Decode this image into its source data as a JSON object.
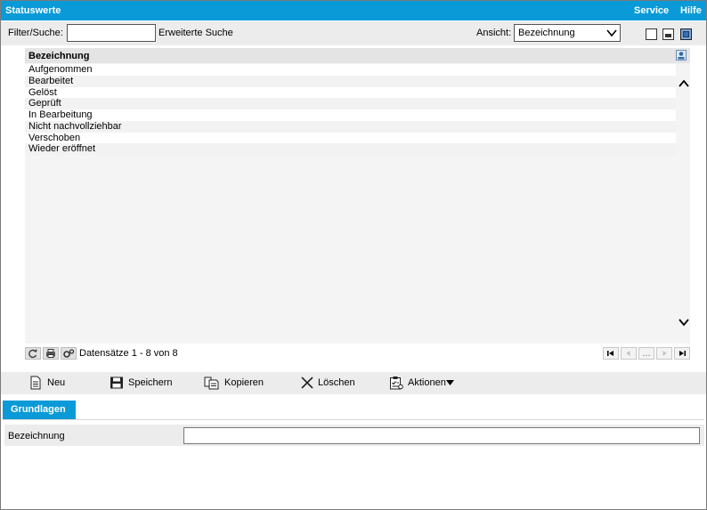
{
  "window": {
    "title": "Statuswerte",
    "menu": [
      "Service",
      "Hilfe"
    ]
  },
  "filter": {
    "label": "Filter/Suche:",
    "value": "",
    "advanced_search": "Erweiterte Suche",
    "view_label": "Ansicht:",
    "view_value": "Bezeichnung"
  },
  "grid": {
    "column": "Bezeichnung",
    "rows": [
      "Aufgenommen",
      "Bearbeitet",
      "Gelöst",
      "Geprüft",
      "In Bearbeitung",
      "Nicht nachvollziehbar",
      "Verschoben",
      "Wieder eröffnet"
    ],
    "records": "Datensätze 1 - 8 von 8",
    "pager_ellipsis": "..."
  },
  "toolbar": {
    "new": "Neu",
    "save": "Speichern",
    "copy": "Kopieren",
    "delete": "Löschen",
    "actions": "Aktionen"
  },
  "form": {
    "tab": "Grundlagen",
    "field_label": "Bezeichnung",
    "field_value": ""
  },
  "colors": {
    "accent": "#0a9ad8",
    "panel": "#ececec"
  }
}
